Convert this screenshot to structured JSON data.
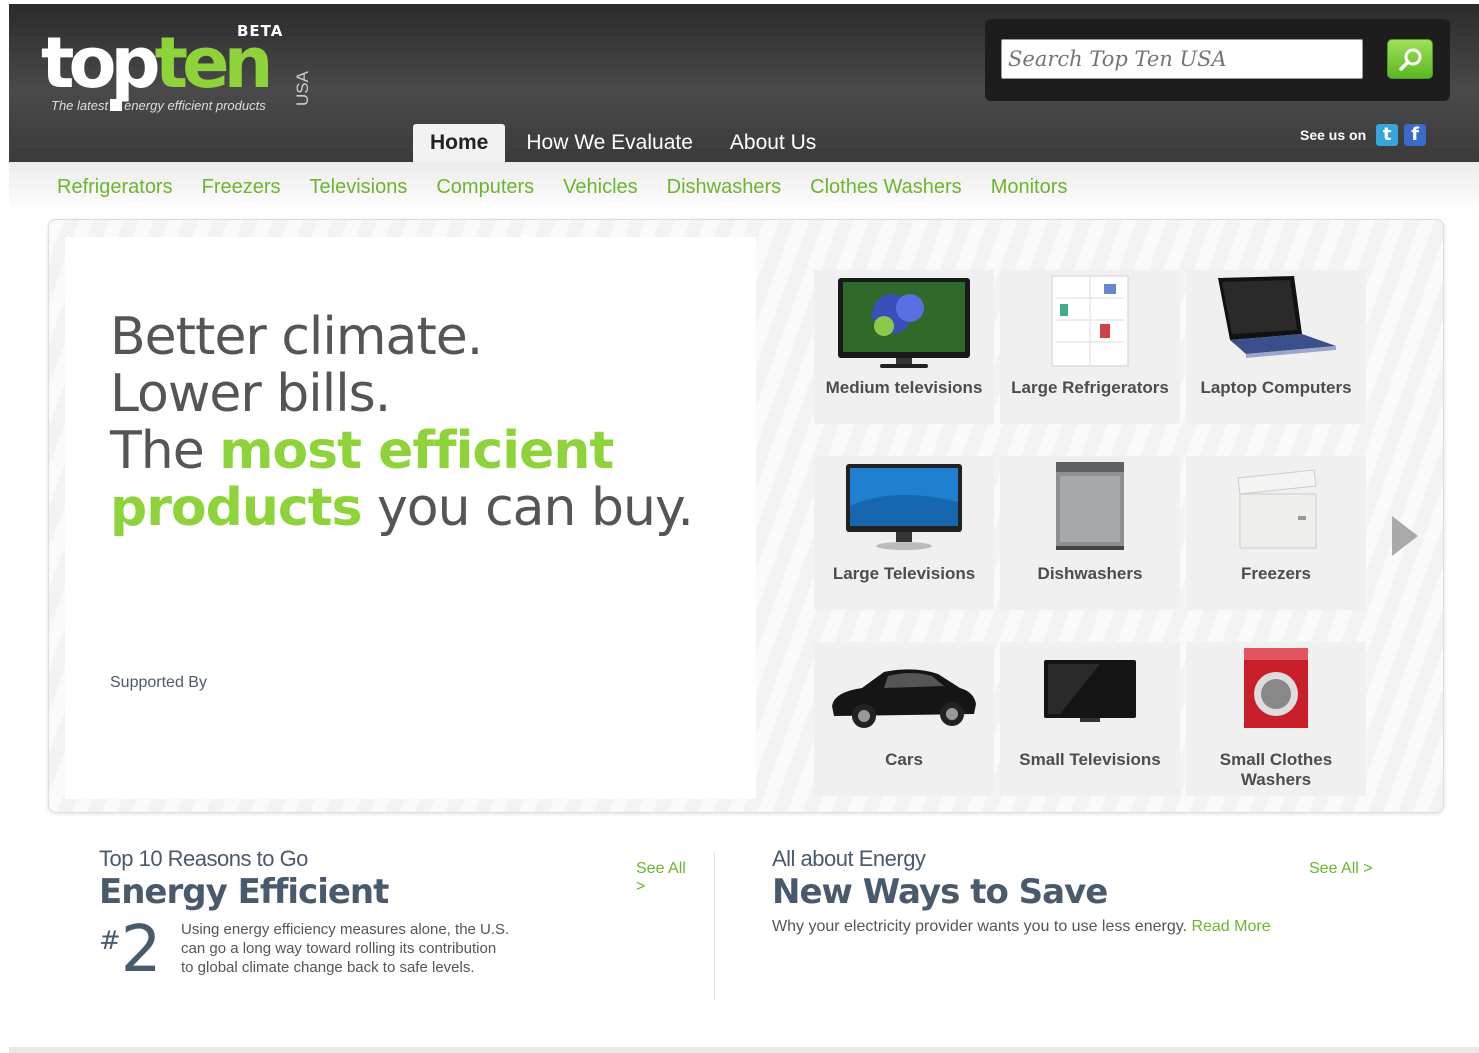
{
  "brand": {
    "logo_text_top": "top",
    "logo_text_ten": "ten",
    "beta": "BETA",
    "usa": "USA",
    "tagline_a": "The latest",
    "tagline_b": "energy efficient products"
  },
  "search": {
    "placeholder": "Search Top Ten USA",
    "value": ""
  },
  "social": {
    "label": "See us on",
    "icons": [
      "twitter-icon",
      "facebook-icon"
    ]
  },
  "nav": {
    "tabs": [
      {
        "label": "Home",
        "active": true
      },
      {
        "label": "How We Evaluate",
        "active": false
      },
      {
        "label": "About Us",
        "active": false
      }
    ]
  },
  "categories": [
    "Refrigerators",
    "Freezers",
    "Televisions",
    "Computers",
    "Vehicles",
    "Dishwashers",
    "Clothes Washers",
    "Monitors"
  ],
  "hero": {
    "line1": "Better climate.",
    "line2": "Lower bills.",
    "line3_a": "The ",
    "line3_b": "most efficient",
    "line4_a": "products",
    "line4_b": " you can buy.",
    "supported_by": "Supported By"
  },
  "tiles": [
    {
      "label": "Medium televisions",
      "icon": "tv-icon"
    },
    {
      "label": "Large Refrigerators",
      "icon": "refrigerator-icon"
    },
    {
      "label": "Laptop Computers",
      "icon": "laptop-icon"
    },
    {
      "label": "Large Televisions",
      "icon": "monitor-icon"
    },
    {
      "label": "Dishwashers",
      "icon": "dishwasher-icon"
    },
    {
      "label": "Freezers",
      "icon": "freezer-icon"
    },
    {
      "label": "Cars",
      "icon": "car-icon"
    },
    {
      "label": "Small Televisions",
      "icon": "small-tv-icon"
    },
    {
      "label": "Small Clothes Washers",
      "icon": "washer-icon"
    }
  ],
  "reasons": {
    "kicker": "Top 10 Reasons to Go",
    "title": "Energy Efficient",
    "see_all": "See All >",
    "number_hash": "#",
    "number": "2",
    "text": "Using energy efficiency measures alone, the U.S. can go a long way toward rolling its contribution to global climate change back to safe levels."
  },
  "energy": {
    "kicker": "All about Energy",
    "title": "New Ways to Save",
    "see_all": "See All >",
    "text": "Why your electricity provider wants you to use less energy. ",
    "read_more": "Read More"
  },
  "colors": {
    "accent_green": "#8fd33a",
    "link_green": "#6cb52d",
    "header_dark": "#3a3a3a",
    "slate": "#4a5a6d"
  }
}
